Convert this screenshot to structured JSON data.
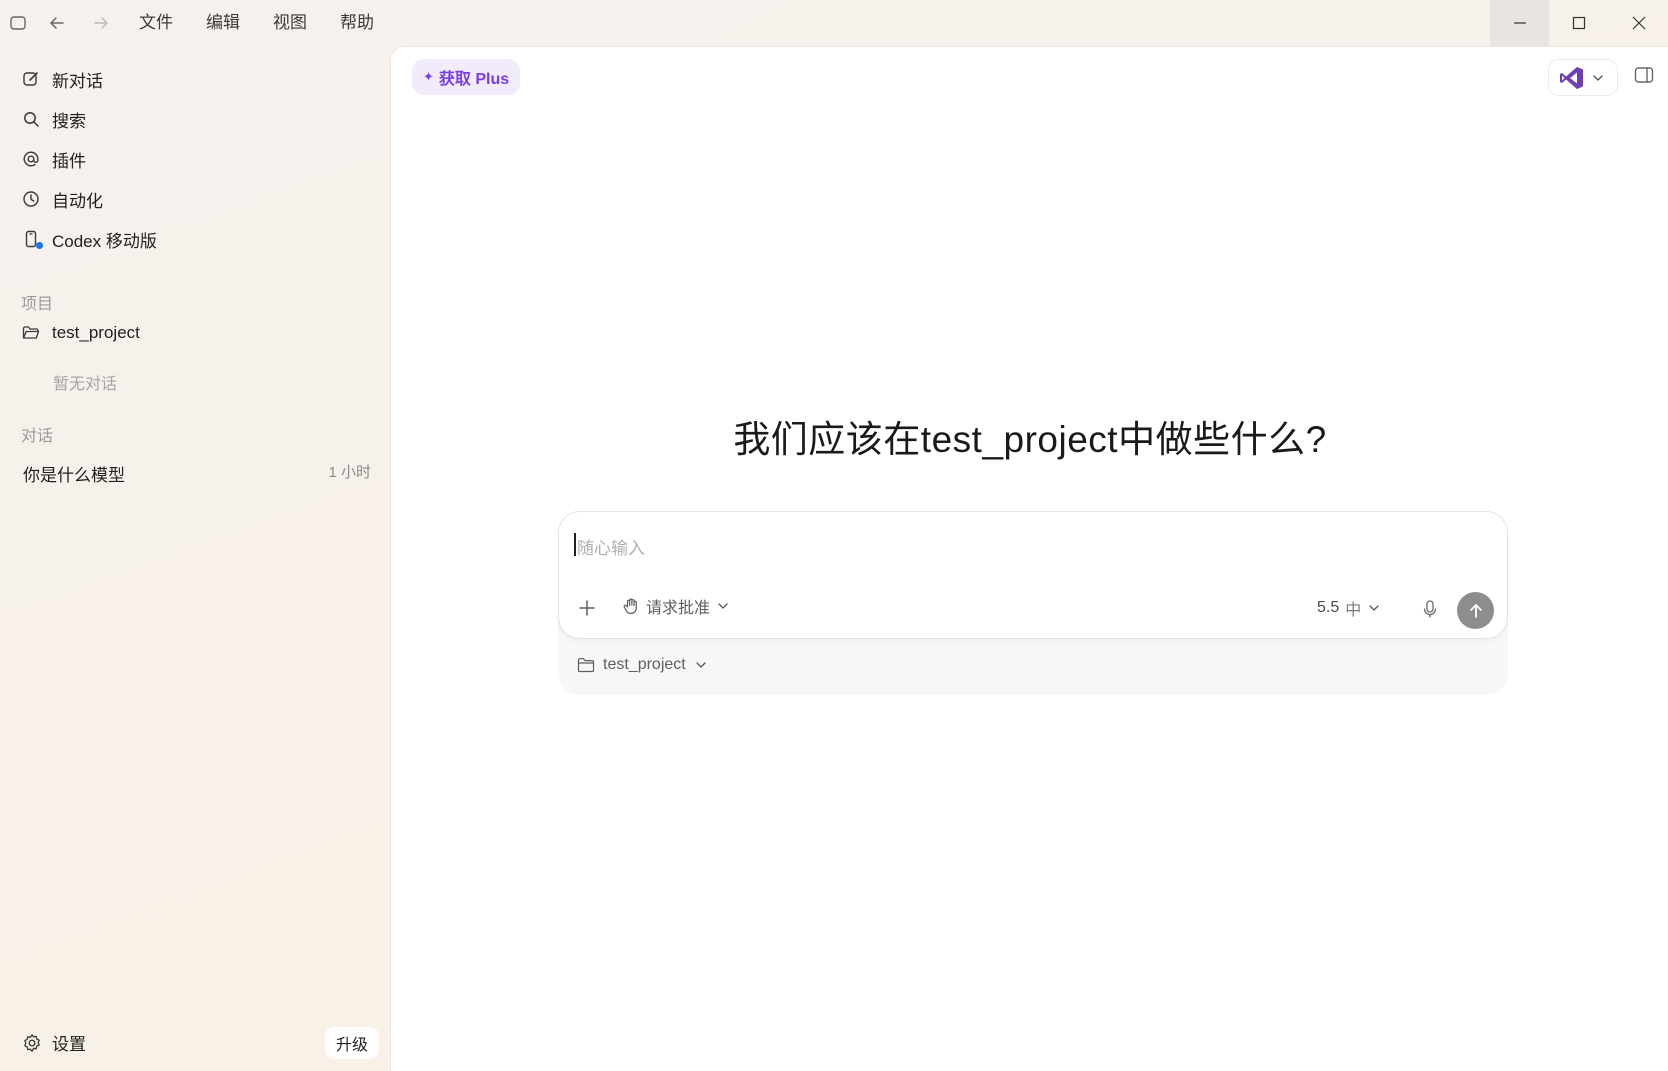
{
  "menu": {
    "file": "文件",
    "edit": "编辑",
    "view": "视图",
    "help": "帮助"
  },
  "sidebar": {
    "nav": [
      {
        "label": "新对话",
        "icon": "edit-icon"
      },
      {
        "label": "搜索",
        "icon": "search-icon"
      },
      {
        "label": "插件",
        "icon": "at-sign-icon"
      },
      {
        "label": "自动化",
        "icon": "clock-icon"
      },
      {
        "label": "Codex 移动版",
        "icon": "mobile-phone-icon"
      }
    ],
    "projects_label": "项目",
    "project": {
      "name": "test_project",
      "empty_note": "暂无对话"
    },
    "conversations_label": "对话",
    "conversations": [
      {
        "title": "你是什么模型",
        "time": "1 小时"
      }
    ],
    "settings_label": "设置",
    "upgrade_label": "升级"
  },
  "main": {
    "plus_chip": {
      "star": "✦",
      "label": "获取 Plus"
    },
    "headline": "我们应该在test_project中做些什么?",
    "composer": {
      "placeholder": "随心输入",
      "approval_label": "请求批准",
      "model_version": "5.5",
      "model_effort": "中",
      "folder_label": "test_project"
    }
  },
  "colors": {
    "accent_purple": "#7a3ee8",
    "notification_dot": "#1a73e8",
    "send_button": "#8d8d8d"
  }
}
